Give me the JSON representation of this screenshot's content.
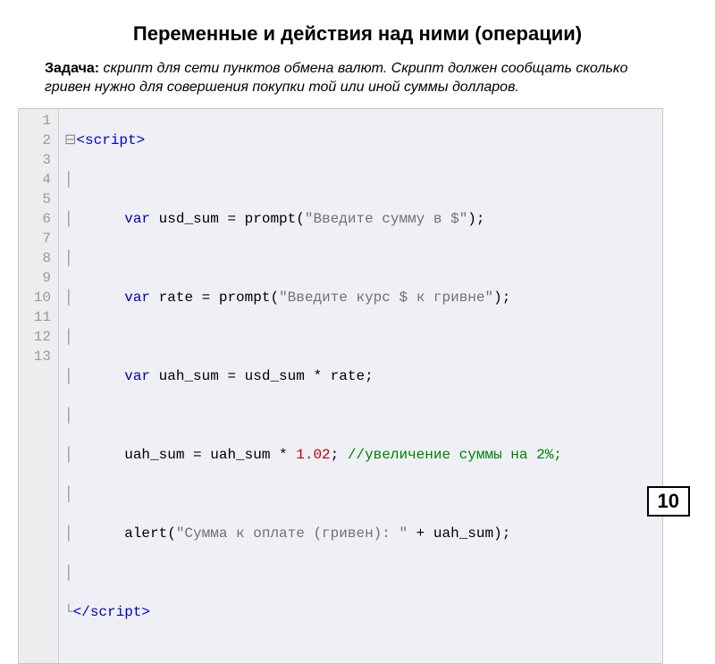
{
  "title": "Переменные и действия над ними (операции)",
  "task": {
    "label": "Задача:",
    "body": "скрипт для сети пунктов обмена валют. Скрипт должен сообщать сколько гривен нужно для совершения покупки той или иной суммы долларов."
  },
  "gutter": [
    "1",
    "2",
    "3",
    "4",
    "5",
    "6",
    "7",
    "8",
    "9",
    "10",
    "11",
    "12",
    "13"
  ],
  "code": {
    "fold_open": "⊟",
    "fold_bar": "│",
    "fold_close": "└",
    "tag_open": "<script>",
    "tag_close": "</script>",
    "kw_var": "var",
    "l3_a": " usd_sum = prompt(",
    "l3_s": "\"Введите сумму в $\"",
    "l3_b": ");",
    "l5_a": " rate = prompt(",
    "l5_s": "\"Введите курс $ к гривне\"",
    "l5_b": ");",
    "l7_a": " uah_sum = usd_sum * rate;",
    "l9_a": "uah_sum = uah_sum * ",
    "l9_n": "1.02",
    "l9_b": "; ",
    "l9_c": "//увеличение суммы на 2%;",
    "l11_a": "alert(",
    "l11_s": "\"Сумма к оплате (гривен): \"",
    "l11_b": " + uah_sum);"
  },
  "page_number": "10"
}
